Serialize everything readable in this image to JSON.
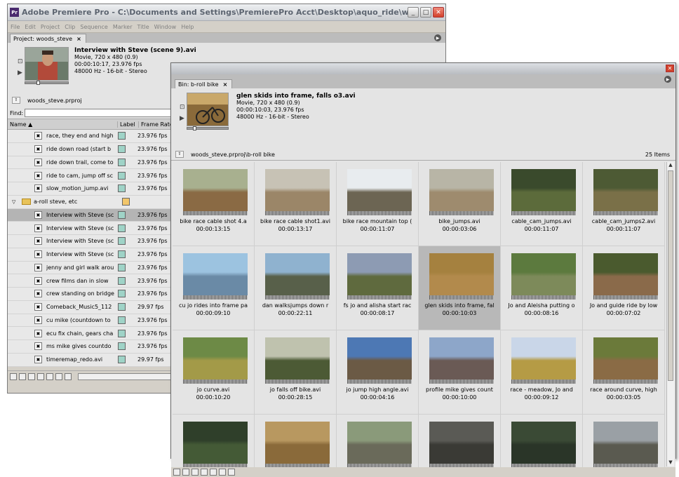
{
  "main_window": {
    "title": "Adobe Premiere Pro - C:\\Documents and Settings\\PremierePro Acct\\Desktop\\aquo_ride\\woods_steve.prproj *",
    "app_icon": "Pr",
    "menus": [
      "File",
      "Edit",
      "Project",
      "Clip",
      "Sequence",
      "Marker",
      "Title",
      "Window",
      "Help"
    ],
    "project_tab": "Project: woods_steve",
    "preview": {
      "clip_name": "Interview with Steve (scene 9).avi",
      "line1": "Movie, 720 x 480 (0.9)",
      "line2": "00:00:10:17, 23.976 fps",
      "line3": "48000 Hz - 16-bit - Stereo"
    },
    "project_file": "woods_steve.prproj",
    "find_label": "Find:",
    "columns": {
      "name": "Name",
      "label": "Label",
      "rate": "Frame Rate"
    },
    "rows": [
      {
        "name": "race, they end and high",
        "rate": "23.976 fps",
        "color": "#9fd3c7"
      },
      {
        "name": "ride down road (start b",
        "rate": "23.976 fps",
        "color": "#9fd3c7"
      },
      {
        "name": "ride down trail, come to",
        "rate": "23.976 fps",
        "color": "#9fd3c7"
      },
      {
        "name": "ride to cam, jump off sc",
        "rate": "23.976 fps",
        "color": "#9fd3c7"
      },
      {
        "name": "slow_motion_jump.avi",
        "rate": "23.976 fps",
        "color": "#9fd3c7"
      }
    ],
    "folder": {
      "name": "a-roll steve, etc",
      "color": "#f2c66a"
    },
    "folder_rows": [
      {
        "name": "Interview with Steve (sc",
        "rate": "23.976 fps",
        "color": "#9fd3c7"
      },
      {
        "name": "Interview with Steve (sc",
        "rate": "23.976 fps",
        "color": "#9fd3c7"
      },
      {
        "name": "Interview with Steve (sc",
        "rate": "23.976 fps",
        "color": "#9fd3c7"
      },
      {
        "name": "Interview with Steve (sc",
        "rate": "23.976 fps",
        "color": "#9fd3c7"
      },
      {
        "name": "jenny and girl walk arou",
        "rate": "23.976 fps",
        "color": "#9fd3c7"
      },
      {
        "name": "crew films dan in slow",
        "rate": "23.976 fps",
        "color": "#9fd3c7"
      },
      {
        "name": "crew standing on bridge",
        "rate": "23.976 fps",
        "color": "#9fd3c7"
      },
      {
        "name": "Comeback_Music5_112",
        "rate": "29.97 fps",
        "color": "#9fd3c7"
      },
      {
        "name": "cu mike (countdown to",
        "rate": "23.976 fps",
        "color": "#9fd3c7"
      },
      {
        "name": "ecu fix chain, gears cha",
        "rate": "23.976 fps",
        "color": "#9fd3c7"
      },
      {
        "name": "ms mike gives countdo",
        "rate": "23.976 fps",
        "color": "#9fd3c7"
      },
      {
        "name": "timeremap_redo.avi",
        "rate": "29.97 fps",
        "color": "#9fd3c7"
      }
    ]
  },
  "bin_window": {
    "tab": "Bin: b-roll bike",
    "preview": {
      "clip_name": "glen skids into frame, falls o3.avi",
      "line1": "Movie, 720 x 480 (0.9)",
      "line2": "00:00:10:03, 23.976 fps",
      "line3": "48000 Hz - 16-bit - Stereo"
    },
    "path": "woods_steve.prproj\\b-roll bike",
    "item_count": "25 Items",
    "clips": [
      {
        "name": "bike race cable shot 4.a",
        "time": "00:00:13:15",
        "sky": "#a8b08f",
        "ground": "#8a6a44"
      },
      {
        "name": "bike race cable shot1.avi",
        "time": "00:00:13:17",
        "sky": "#c7c2b5",
        "ground": "#9b8668"
      },
      {
        "name": "bike race mountain top (",
        "time": "00:00:11:07",
        "sky": "#e8ecef",
        "ground": "#6c6553"
      },
      {
        "name": "bike_jumps.avi",
        "time": "00:00:03:06",
        "sky": "#b8b5a6",
        "ground": "#9e8b6e"
      },
      {
        "name": "cable_cam_jumps.avi",
        "time": "00:00:11:07",
        "sky": "#3a4a2c",
        "ground": "#5c6b3b"
      },
      {
        "name": "cable_cam_jumps2.avi",
        "time": "00:00:11:07",
        "sky": "#4d5a34",
        "ground": "#7a7048"
      },
      {
        "name": "cu jo rides into frame pa",
        "time": "00:00:09:10",
        "sky": "#9cc3e0",
        "ground": "#6a8aa6"
      },
      {
        "name": "dan walksjumps down r",
        "time": "00:00:22:11",
        "sky": "#8fb2cf",
        "ground": "#58604a"
      },
      {
        "name": "fs jo and alisha start rac",
        "time": "00:00:08:17",
        "sky": "#8d9bb3",
        "ground": "#5f6a3e"
      },
      {
        "name": "glen skids into frame, fal",
        "time": "00:00:10:03",
        "sky": "#a5813f",
        "ground": "#b28a4c"
      },
      {
        "name": "Jo and Aleisha putting o",
        "time": "00:00:08:16",
        "sky": "#5c7a3e",
        "ground": "#7d8a5a"
      },
      {
        "name": "Jo and guide ride by low",
        "time": "00:00:07:02",
        "sky": "#4a5a2e",
        "ground": "#8a6a4a"
      },
      {
        "name": "jo curve.avi",
        "time": "00:00:10:20",
        "sky": "#6d8a46",
        "ground": "#a39a48"
      },
      {
        "name": "jo falls off bike.avi",
        "time": "00:00:28:15",
        "sky": "#bfc2ae",
        "ground": "#4c5a35"
      },
      {
        "name": "jo jump high angle.avi",
        "time": "00:00:04:16",
        "sky": "#4d78b4",
        "ground": "#6b5a45"
      },
      {
        "name": "profile mike gives count",
        "time": "00:00:10:00",
        "sky": "#8da6c9",
        "ground": "#6a5a55"
      },
      {
        "name": "race - meadow, Jo and",
        "time": "00:00:09:12",
        "sky": "#c9d6e8",
        "ground": "#b59b45"
      },
      {
        "name": "race around curve, high",
        "time": "00:00:03:05",
        "sky": "#6b7a3a",
        "ground": "#8a6b45"
      },
      {
        "name": "",
        "time": "",
        "sky": "#2f3f2a",
        "ground": "#445a36"
      },
      {
        "name": "",
        "time": "",
        "sky": "#b89860",
        "ground": "#8a6a3a"
      },
      {
        "name": "",
        "time": "",
        "sky": "#8a9a7a",
        "ground": "#6a6a5a"
      },
      {
        "name": "",
        "time": "",
        "sky": "#5a5a55",
        "ground": "#3a3a35"
      },
      {
        "name": "",
        "time": "",
        "sky": "#3a4a35",
        "ground": "#2a3528"
      },
      {
        "name": "",
        "time": "",
        "sky": "#9aa0a5",
        "ground": "#5a5a50"
      }
    ]
  }
}
